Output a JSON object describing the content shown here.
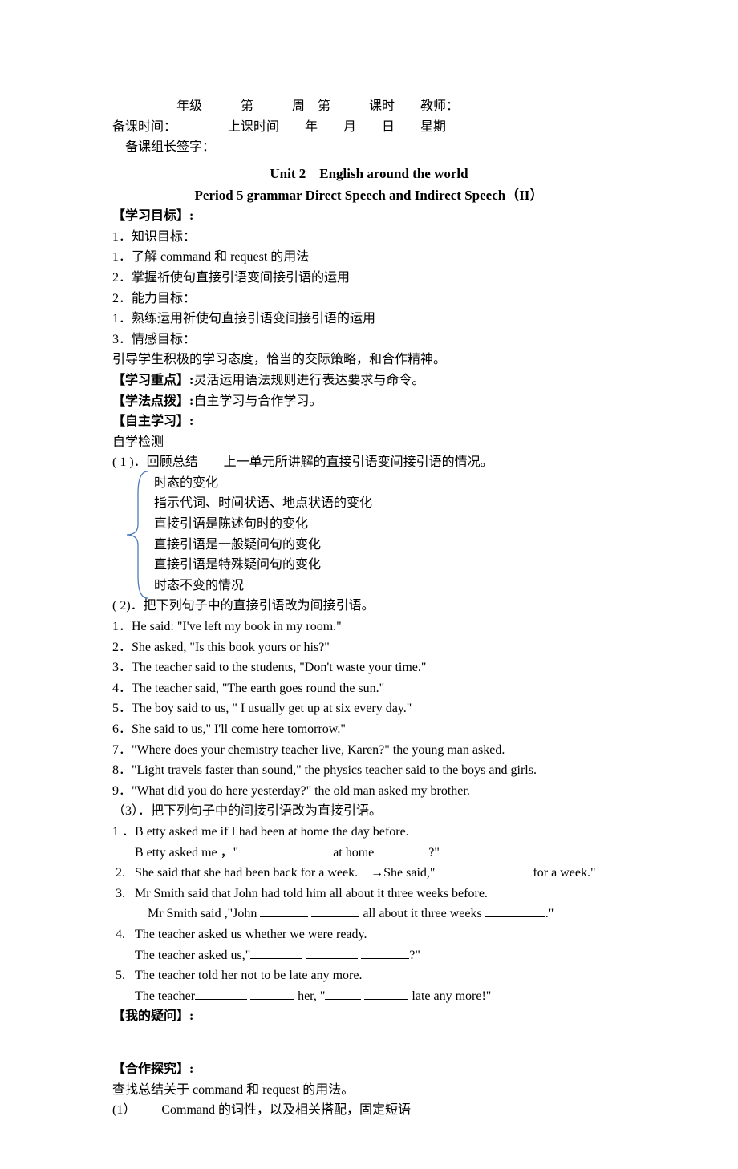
{
  "header": {
    "line1": "年级   第   周 第   课时  教师：",
    "line2": "备课时间：    上课时间  年  月  日  星期",
    "line3": " 备课组长签字："
  },
  "title": "Unit 2 English around the world",
  "subtitle": "Period 5 grammar Direct Speech and Indirect Speech（II）",
  "learning_objectives": {
    "label": "【学习目标】:",
    "knowledge_label": "1．知识目标：",
    "knowledge_items": [
      "1．了解 command 和 request 的用法",
      "2．掌握祈使句直接引语变间接引语的运用"
    ],
    "ability_label": "2．能力目标：",
    "ability_items": [
      "1．熟练运用祈使句直接引语变间接引语的运用"
    ],
    "emotion_label": "3．情感目标：",
    "emotion_text": "引导学生积极的学习态度，恰当的交际策略，和合作精神。"
  },
  "focus": {
    "label": "【学习重点】:",
    "text": "灵活运用语法规则进行表达要求与命令。"
  },
  "method": {
    "label": "【学法点拨】:",
    "text": "自主学习与合作学习。"
  },
  "self_study": {
    "label": "【自主学习】:",
    "subtitle": "自学检测",
    "section1_label": "( 1 )．回顾总结  上一单元所讲解的直接引语变间接引语的情况。",
    "bracket_items": [
      "时态的变化",
      "指示代词、时间状语、地点状语的变化",
      "直接引语是陈述句时的变化",
      "直接引语是一般疑问句的变化",
      "直接引语是特殊疑问句的变化",
      "时态不变的情况"
    ],
    "section2_label": "( 2)．把下列句子中的直接引语改为间接引语。",
    "section2_items": [
      "1．He said: \"I've left my book in my room.\"",
      "2．She asked, \"Is this book yours or his?\"",
      "3．The teacher said to the students, \"Don't waste your time.\"",
      "4．The teacher said, \"The earth goes round the sun.\"",
      "5．The boy said to us, \" I usually get up at six every day.\"",
      "6．She said to us,\" I'll come here tomorrow.\"",
      "7．\"Where does your chemistry teacher live, Karen?\" the young man asked.",
      "8．\"Light travels faster than sound,\" the physics teacher said to the boys and girls.",
      "9．\"What did you do here yesterday?\" the old man asked my brother."
    ],
    "section3_label": "（3）．把下列句子中的间接引语改为直接引语。",
    "section3_items": [
      {
        "num": "1 ．",
        "line1": "B etty asked me if I had been at home the day before.",
        "line2_pre": "B etty asked me ，\"",
        "line2_mid": " at home ",
        "line2_post": " ?\""
      },
      {
        "num": "2.",
        "line1_pre": "She said that she had been back for a week. →She said,\"",
        "line1_post": " for a week.\""
      },
      {
        "num": "3.",
        "line1": "Mr Smith said that John had told him all about it three weeks before.",
        "line2_pre": " Mr Smith said ,\"John ",
        "line2_mid": " all about it three weeks ",
        "line2_post": ".\""
      },
      {
        "num": "4.",
        "line1": "The teacher asked us whether we were ready.",
        "line2_pre": "The teacher asked us,\"",
        "line2_post": "?\""
      },
      {
        "num": "5.",
        "line1": "The teacher told her not to be late any more.",
        "line2_pre": "The teacher",
        "line2_mid": " her, \"",
        "line2_post": " late any more!\""
      }
    ]
  },
  "my_question_label": "【我的疑问】:",
  "cooperation": {
    "label": "【合作探究】:",
    "intro": "查找总结关于 command 和 request 的用法。",
    "item1": "(1）  Command 的词性，以及相关搭配，固定短语"
  }
}
